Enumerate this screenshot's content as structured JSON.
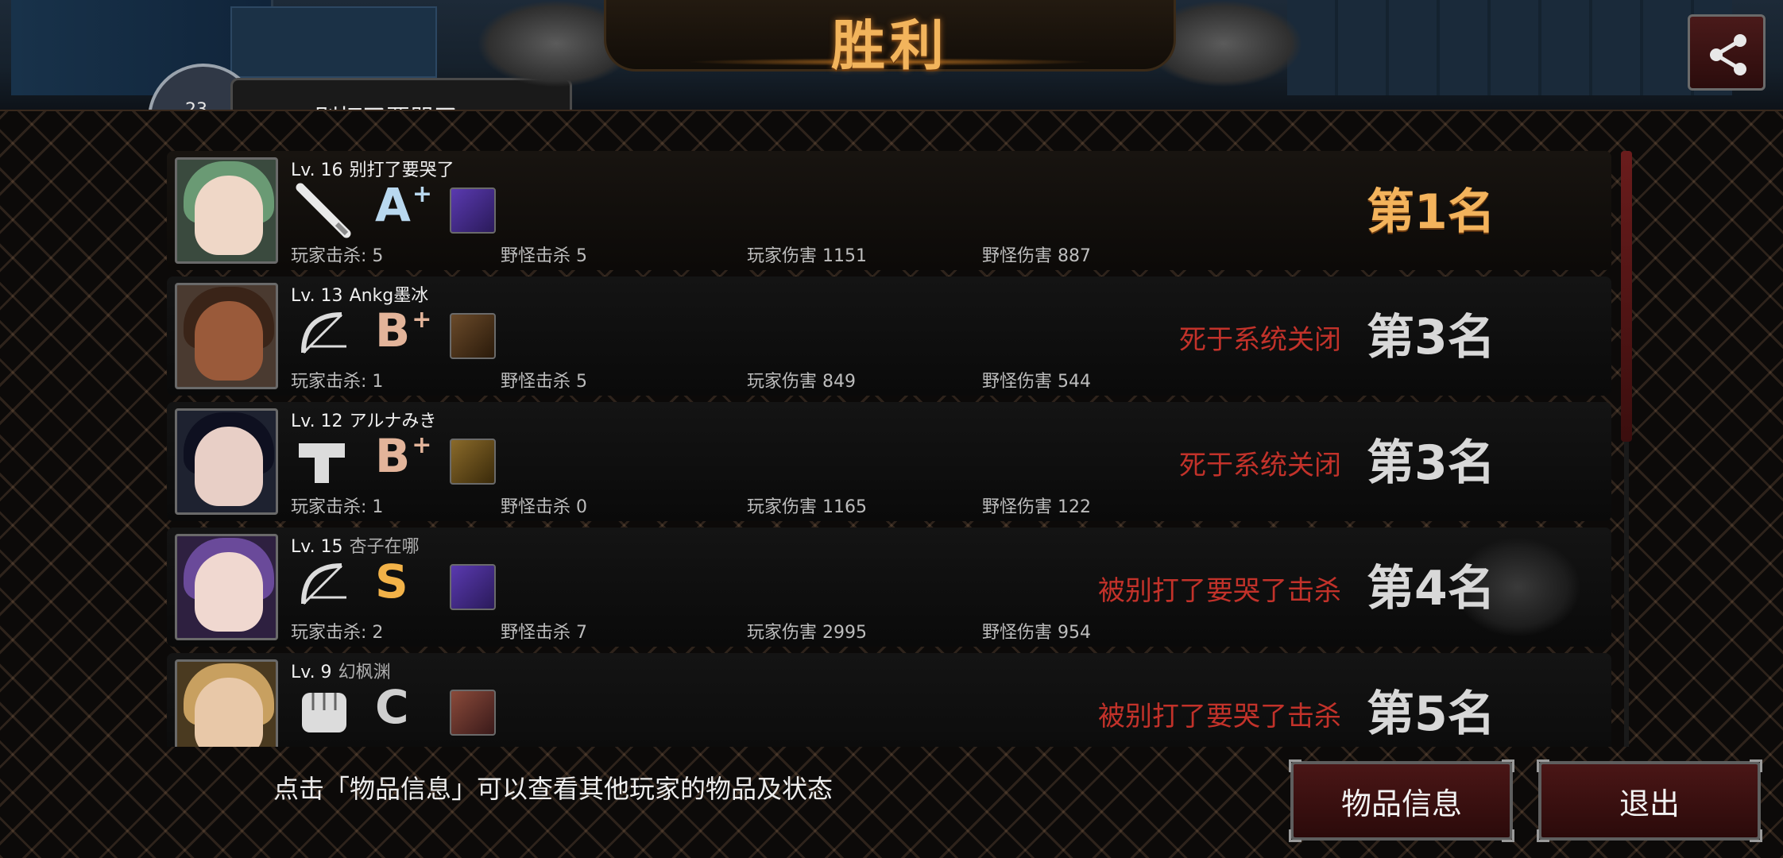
{
  "title": "胜利",
  "header_peek": {
    "name": "别打了要哭了",
    "number": "23"
  },
  "players": [
    {
      "level": "Lv. 16",
      "name": "别打了要哭了",
      "weapon": "baseball-bat",
      "grade": "A",
      "grade_plus": "+",
      "grade_color": "#b9d8ef",
      "item": "purple-gun-item",
      "player_kills_label": "玩家击杀:",
      "player_kills": "5",
      "monster_kills_label": "野怪击杀",
      "monster_kills": "5",
      "player_damage_label": "玩家伤害",
      "player_damage": "1151",
      "monster_damage_label": "野怪伤害",
      "monster_damage": "887",
      "status": "",
      "rank": "第1名",
      "rank_color": "gold"
    },
    {
      "level": "Lv. 13",
      "name": "Ankg墨冰",
      "weapon": "bow",
      "grade": "B",
      "grade_plus": "+",
      "grade_color": "#e3b49a",
      "item": "crossbow-item",
      "player_kills_label": "玩家击杀:",
      "player_kills": "1",
      "monster_kills_label": "野怪击杀",
      "monster_kills": "5",
      "player_damage_label": "玩家伤害",
      "player_damage": "849",
      "monster_damage_label": "野怪伤害",
      "monster_damage": "544",
      "status": "死于系统关闭",
      "rank": "第3名",
      "rank_color": "silver"
    },
    {
      "level": "Lv. 12",
      "name": "アルナみき",
      "weapon": "pistol",
      "grade": "B",
      "grade_plus": "+",
      "grade_color": "#e3b49a",
      "item": "ammo-item",
      "player_kills_label": "玩家击杀:",
      "player_kills": "1",
      "monster_kills_label": "野怪击杀",
      "monster_kills": "0",
      "player_damage_label": "玩家伤害",
      "player_damage": "1165",
      "monster_damage_label": "野怪伤害",
      "monster_damage": "122",
      "status": "死于系统关闭",
      "rank": "第3名",
      "rank_color": "silver"
    },
    {
      "level": "Lv. 15",
      "name": "杏子在哪",
      "weapon": "bow",
      "grade": "S",
      "grade_plus": "",
      "grade_color": "#f2b248",
      "item": "purple-gun-item",
      "player_kills_label": "玩家击杀:",
      "player_kills": "2",
      "monster_kills_label": "野怪击杀",
      "monster_kills": "7",
      "player_damage_label": "玩家伤害",
      "player_damage": "2995",
      "monster_damage_label": "野怪伤害",
      "monster_damage": "954",
      "status": "被别打了要哭了击杀",
      "rank": "第4名",
      "rank_color": "silver"
    },
    {
      "level": "Lv. 9",
      "name": "幻枫渊",
      "weapon": "fist",
      "grade": "C",
      "grade_plus": "",
      "grade_color": "#cfcfcf",
      "item": "character-item",
      "player_kills_label": "",
      "player_kills": "",
      "monster_kills_label": "",
      "monster_kills": "",
      "player_damage_label": "",
      "player_damage": "",
      "monster_damage_label": "",
      "monster_damage": "",
      "status": "被别打了要哭了击杀",
      "rank": "第5名",
      "rank_color": "silver"
    }
  ],
  "hint": "点击「物品信息」可以查看其他玩家的物品及状态",
  "buttons": {
    "item_info": "物品信息",
    "exit": "退出"
  },
  "colors": {
    "accent_gold": "#f2b45c",
    "status_red": "#c2322a",
    "button_red": "#4a1616"
  }
}
